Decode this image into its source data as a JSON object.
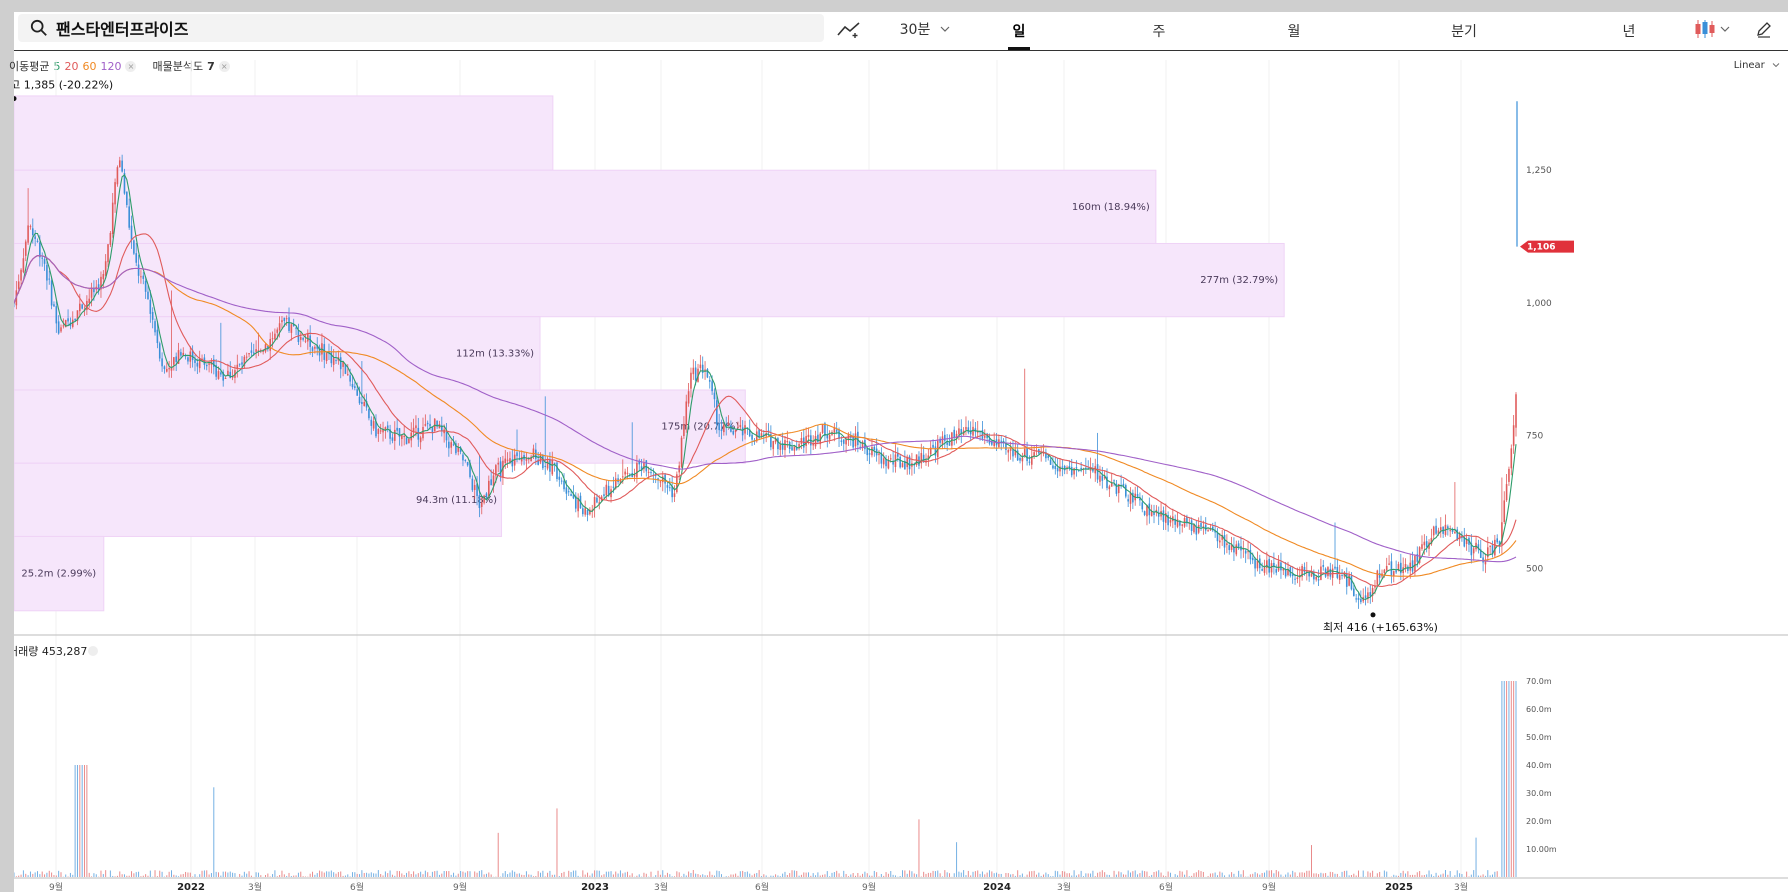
{
  "search": {
    "value": "팬스타엔터프라이즈"
  },
  "toolbar": {
    "interval": "30분",
    "tabs": [
      "일",
      "주",
      "월",
      "분기",
      "년"
    ],
    "active_tab": "일"
  },
  "indicators": {
    "ma_label": "이동평균",
    "ma_periods": [
      "5",
      "20",
      "60",
      "120"
    ],
    "ma_colors": [
      "#2e9c6a",
      "#e05b5b",
      "#f08a24",
      "#a060c8"
    ],
    "volume_profile_label": "매물분석도",
    "volume_profile_value": "7"
  },
  "scale_mode": "Linear",
  "colors": {
    "up": "#e05b5b",
    "down": "#3a8fd8",
    "profile_fill": "#f6e6fb",
    "current_price_tag": "#e0313b"
  },
  "chart_data": {
    "type": "candlestick",
    "x_axis_labels": [
      "9월",
      "2022",
      "3월",
      "6월",
      "9월",
      "2023",
      "3월",
      "6월",
      "9월",
      "2024",
      "3월",
      "6월",
      "9월",
      "2025",
      "3월"
    ],
    "y_ticks": [
      "1,250",
      "1,000",
      "750",
      "500"
    ],
    "ylim": [
      380,
      1420
    ],
    "current_price": "1,106",
    "annotations": {
      "high": {
        "label": "최고",
        "value": "1,385 (-20.22%)",
        "price": 1385
      },
      "low": {
        "label": "최저",
        "value": "416 (+165.63%)",
        "price": 416
      }
    },
    "volume_profile": [
      {
        "from": 1250,
        "to": 1390,
        "label": "",
        "fraction": 0.42
      },
      {
        "from": 1112,
        "to": 1250,
        "label": "160m (18.94%)",
        "fraction": 0.89
      },
      {
        "from": 974,
        "to": 1112,
        "label": "277m (32.79%)",
        "fraction": 0.99
      },
      {
        "from": 836,
        "to": 974,
        "label": "112m (13.33%)",
        "fraction": 0.41
      },
      {
        "from": 698,
        "to": 836,
        "label": "175m (20.77%)",
        "fraction": 0.57
      },
      {
        "from": 560,
        "to": 698,
        "label": "94.3m (11.18%)",
        "fraction": 0.38
      },
      {
        "from": 420,
        "to": 560,
        "label": "25.2m (2.99%)",
        "fraction": 0.07
      }
    ],
    "price_path": [
      [
        0.0,
        1000
      ],
      [
        0.01,
        1150
      ],
      [
        0.02,
        1080
      ],
      [
        0.03,
        940
      ],
      [
        0.04,
        980
      ],
      [
        0.05,
        1010
      ],
      [
        0.06,
        1050
      ],
      [
        0.07,
        1280
      ],
      [
        0.08,
        1080
      ],
      [
        0.09,
        1000
      ],
      [
        0.1,
        870
      ],
      [
        0.11,
        910
      ],
      [
        0.13,
        880
      ],
      [
        0.14,
        860
      ],
      [
        0.16,
        900
      ],
      [
        0.18,
        960
      ],
      [
        0.2,
        920
      ],
      [
        0.22,
        880
      ],
      [
        0.24,
        760
      ],
      [
        0.26,
        745
      ],
      [
        0.28,
        770
      ],
      [
        0.3,
        700
      ],
      [
        0.31,
        620
      ],
      [
        0.32,
        680
      ],
      [
        0.34,
        720
      ],
      [
        0.36,
        690
      ],
      [
        0.38,
        600
      ],
      [
        0.4,
        660
      ],
      [
        0.42,
        700
      ],
      [
        0.44,
        640
      ],
      [
        0.45,
        860
      ],
      [
        0.46,
        880
      ],
      [
        0.47,
        760
      ],
      [
        0.48,
        760
      ],
      [
        0.5,
        745
      ],
      [
        0.52,
        730
      ],
      [
        0.54,
        760
      ],
      [
        0.56,
        740
      ],
      [
        0.58,
        700
      ],
      [
        0.6,
        700
      ],
      [
        0.62,
        740
      ],
      [
        0.64,
        760
      ],
      [
        0.66,
        720
      ],
      [
        0.68,
        710
      ],
      [
        0.7,
        690
      ],
      [
        0.72,
        680
      ],
      [
        0.74,
        640
      ],
      [
        0.76,
        600
      ],
      [
        0.78,
        580
      ],
      [
        0.8,
        560
      ],
      [
        0.82,
        520
      ],
      [
        0.84,
        500
      ],
      [
        0.86,
        490
      ],
      [
        0.88,
        490
      ],
      [
        0.89,
        470
      ],
      [
        0.9,
        430
      ],
      [
        0.91,
        500
      ],
      [
        0.93,
        500
      ],
      [
        0.94,
        550
      ],
      [
        0.95,
        580
      ],
      [
        0.96,
        560
      ],
      [
        0.97,
        540
      ],
      [
        0.98,
        520
      ],
      [
        0.99,
        560
      ],
      [
        1.0,
        820
      ]
    ],
    "volume_panel": {
      "label": "거래량",
      "value": "453,287",
      "y_ticks": [
        "70.0m",
        "60.0m",
        "50.0m",
        "40.0m",
        "30.0m",
        "20.0m",
        "10.00m"
      ]
    }
  }
}
